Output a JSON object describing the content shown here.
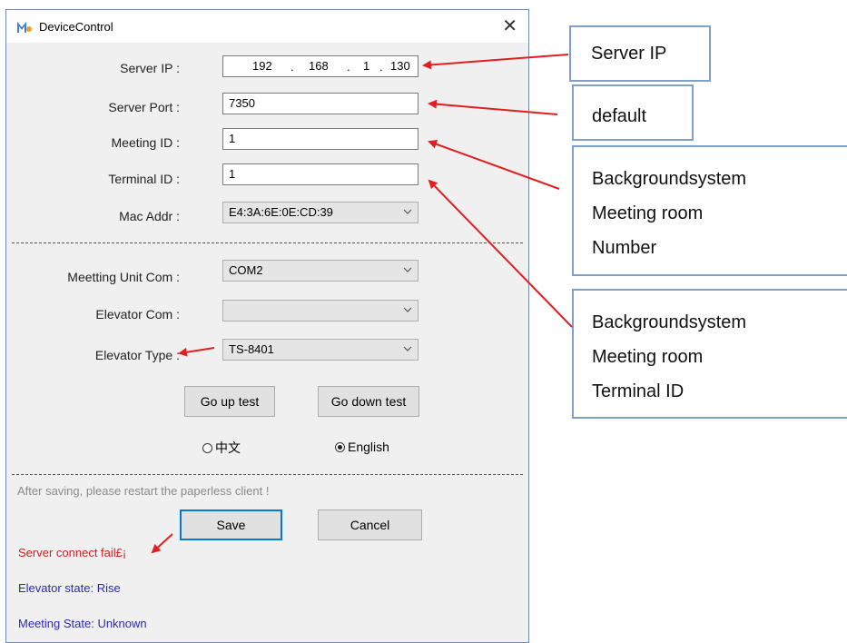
{
  "window": {
    "title": "DeviceControl"
  },
  "form": {
    "server_ip_label": "Server IP :",
    "server_ip": [
      "192",
      "168",
      "1",
      "130"
    ],
    "server_port_label": "Server Port :",
    "server_port": "7350",
    "meeting_id_label": "Meeting ID :",
    "meeting_id": "1",
    "terminal_id_label": "Terminal ID :",
    "terminal_id": "1",
    "mac_label": "Mac Addr :",
    "mac_value": "E4:3A:6E:0E:CD:39",
    "unit_com_label": "Meetting Unit Com :",
    "unit_com_value": "COM2",
    "elevator_com_label": "Elevator Com :",
    "elevator_com_value": "",
    "elevator_type_label": "Elevator Type :",
    "elevator_type_value": "TS-8401"
  },
  "buttons": {
    "go_up": "Go up test",
    "go_down": "Go down test",
    "save": "Save",
    "cancel": "Cancel"
  },
  "language": {
    "chinese": "中文",
    "english": "English",
    "selected": "english"
  },
  "hint": "After saving, please restart the paperless client !",
  "status": {
    "server": "Server connect fail£¡",
    "elevator": "Elevator state: Rise",
    "meeting": "Meeting State: Unknown"
  },
  "callouts": {
    "server_ip": "Server IP",
    "default": "default",
    "meeting_room_number": [
      "Backgroundsystem",
      "Meeting room",
      "Number"
    ],
    "terminal_id": [
      "Backgroundsystem",
      "Meeting room",
      "Terminal ID"
    ]
  },
  "colors": {
    "status_error": "#d02020",
    "status_info": "#2b2bb0",
    "arrow": "#e02020",
    "callout_border": "#7f9fc7"
  }
}
